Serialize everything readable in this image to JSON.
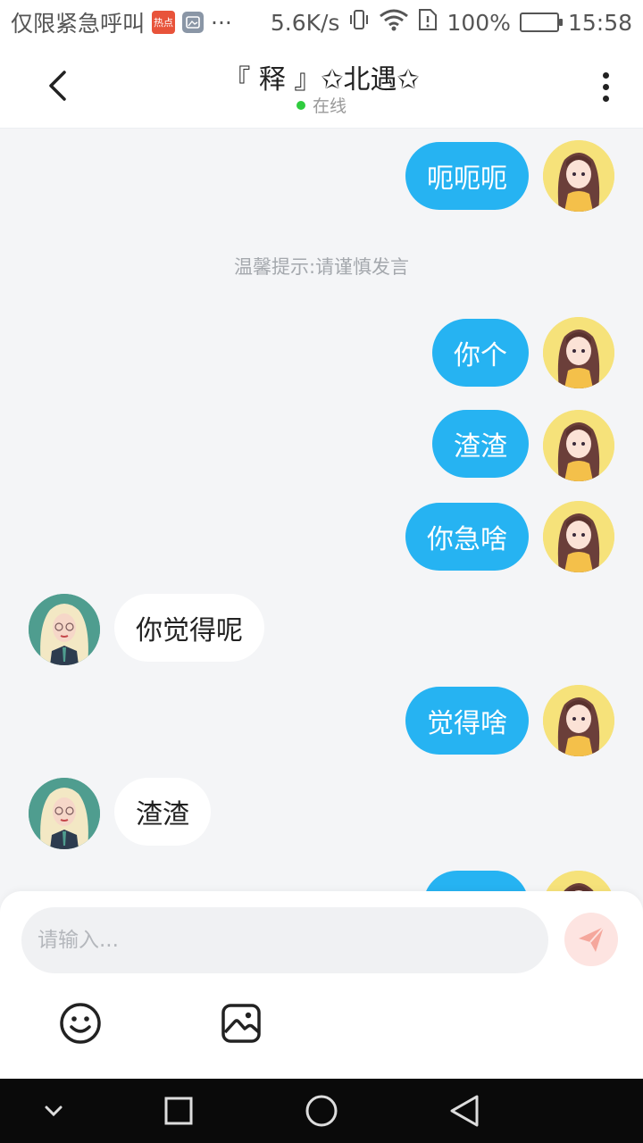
{
  "status_bar": {
    "carrier_text": "仅限紧急呼叫",
    "badge_text": "热点",
    "more": "···",
    "net_speed": "5.6K/s",
    "battery": "100%",
    "time": "15:58"
  },
  "header": {
    "title": "『 释 』✩北遇✩",
    "presence": "在线"
  },
  "chat": {
    "messages": [
      {
        "from": "me",
        "text": "呃呃呃"
      },
      {
        "from": "system",
        "text": "温馨提示:请谨慎发言"
      },
      {
        "from": "me",
        "text": "你个"
      },
      {
        "from": "me",
        "text": "渣渣"
      },
      {
        "from": "me",
        "text": "你急啥"
      },
      {
        "from": "other",
        "text": "你觉得呢"
      },
      {
        "from": "me",
        "text": "觉得啥"
      },
      {
        "from": "other",
        "text": "渣渣"
      }
    ]
  },
  "composer": {
    "placeholder": "请输入...",
    "send_icon": "send-icon",
    "emoji_icon": "emoji-icon",
    "image_icon": "image-icon"
  },
  "colors": {
    "my_bubble": "#26b3f2",
    "other_bubble": "#ffffff",
    "online_dot": "#2fcc3e",
    "send_button_bg": "#fde4e1",
    "send_icon": "#f28b7c"
  }
}
